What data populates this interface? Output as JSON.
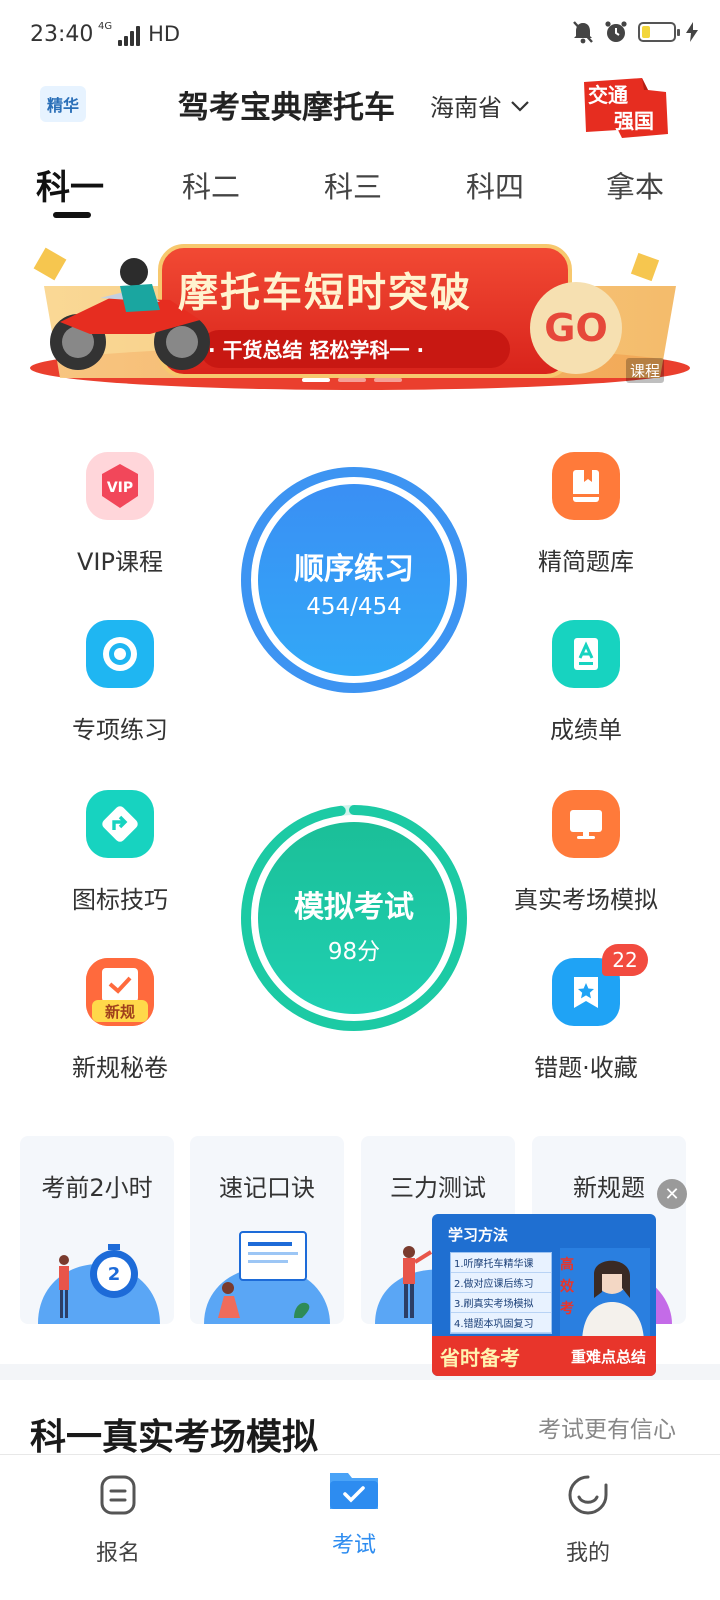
{
  "status_bar": {
    "time": "23:40",
    "network": "4G",
    "hd": "HD",
    "battery_level": 0.25
  },
  "header": {
    "badge": "精华",
    "title": "驾考宝典摩托车",
    "region": "海南省",
    "logo_top": "交通",
    "logo_bottom": "强国"
  },
  "tabs": [
    "科一",
    "科二",
    "科三",
    "科四",
    "拿本"
  ],
  "active_tab": "科一",
  "banner": {
    "title": "摩托车短时突破",
    "subtitle": "· 干货总结 轻松学科一 ·",
    "go": "GO",
    "tag": "课程"
  },
  "features": {
    "vip_course": "VIP课程",
    "vip_icon_text": "VIP",
    "special_practice": "专项练习",
    "sign_tips": "图标技巧",
    "new_rules_secret": "新规秘卷",
    "new_rules_tag": "新规",
    "question_bank": "精简题库",
    "score_report": "成绩单",
    "real_exam_sim": "真实考场模拟",
    "mistakes_favorites": "错题·收藏",
    "mistakes_count": "22"
  },
  "sequential_practice": {
    "title": "顺序练习",
    "progress": "454/454",
    "done": 454,
    "total": 454
  },
  "mock_exam": {
    "title": "模拟考试",
    "score": "98分",
    "score_value": 98
  },
  "cards": [
    {
      "label": "考前2小时"
    },
    {
      "label": "速记口诀"
    },
    {
      "label": "三力测试"
    },
    {
      "label": "新规题"
    }
  ],
  "float_ad": {
    "header": "学习方法",
    "steps": [
      "1.听摩托车精华课",
      "2.做对应课后练习",
      "3.刷真实考场模拟",
      "4.错题本巩固复习"
    ],
    "side_text": "高效考",
    "footer_left": "省时备考",
    "footer_right": "重难点总结"
  },
  "section": {
    "title": "科一真实考场模拟",
    "extra": "考试更有信心"
  },
  "bottom_nav": [
    {
      "label": "报名"
    },
    {
      "label": "考试"
    },
    {
      "label": "我的"
    }
  ],
  "active_nav": "考试",
  "colors": {
    "primary_blue": "#2d8cf0",
    "practice_circle": "#2f8ff2",
    "exam_circle": "#19c9a6",
    "badge_red": "#f24b3f"
  }
}
